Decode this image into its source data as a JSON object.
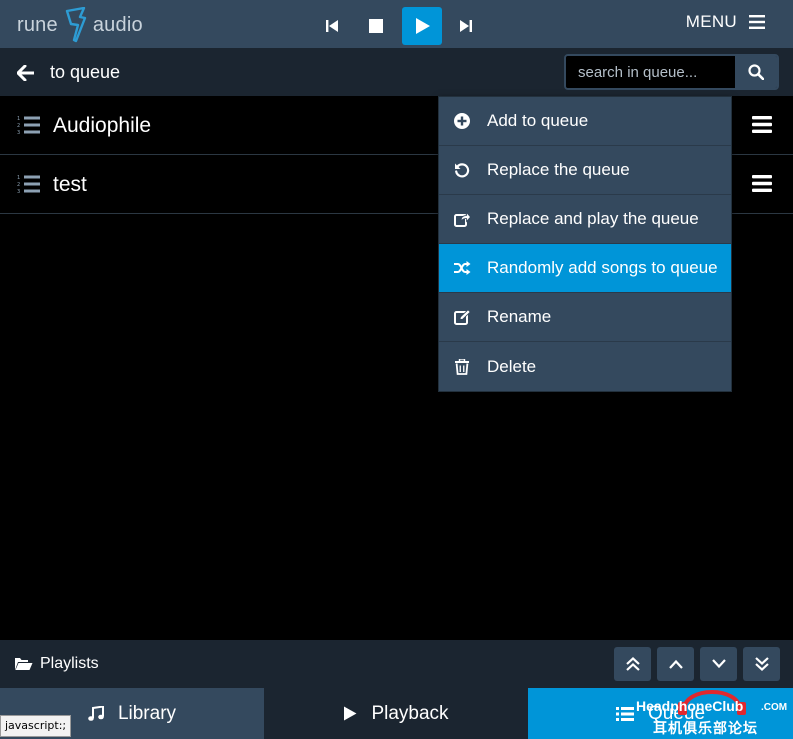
{
  "header": {
    "logo_left": "rune",
    "logo_right": "audio",
    "menu_label": "MENU"
  },
  "subheader": {
    "back_label": "to queue",
    "search_placeholder": "search in queue..."
  },
  "playlists": [
    {
      "name": "Audiophile"
    },
    {
      "name": "test"
    }
  ],
  "context_menu": {
    "items": [
      {
        "label": "Add to queue",
        "icon": "plus-circle-icon"
      },
      {
        "label": "Replace the queue",
        "icon": "undo-icon"
      },
      {
        "label": "Replace and play the queue",
        "icon": "share-icon"
      },
      {
        "label": "Randomly add songs to queue",
        "icon": "shuffle-icon",
        "active": true
      },
      {
        "label": "Rename",
        "icon": "edit-icon"
      },
      {
        "label": "Delete",
        "icon": "trash-icon"
      }
    ]
  },
  "footer": {
    "playlists_label": "Playlists"
  },
  "tabs": {
    "library": "Library",
    "playback": "Playback",
    "queue": "Queue"
  },
  "status_bar": "javascript:;",
  "watermark": {
    "text": "HeadphoneClub",
    "domain": ".COM",
    "chinese": "耳机俱乐部论坛"
  },
  "colors": {
    "accent": "#0095d8",
    "bar": "#34495e",
    "dark_bar": "#1b2530",
    "background": "#000000"
  }
}
